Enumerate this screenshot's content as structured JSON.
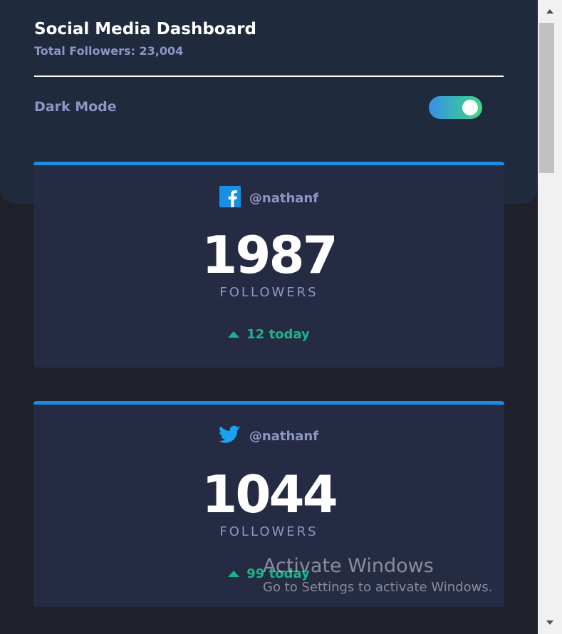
{
  "header": {
    "title": "Social Media Dashboard",
    "subtitle": "Total Followers: 23,004"
  },
  "dark_mode": {
    "label": "Dark Mode",
    "enabled": true
  },
  "cards": [
    {
      "platform": "facebook",
      "icon": "facebook-icon",
      "accent": "#178fe6",
      "handle": "@nathanf",
      "count": "1987",
      "metric_label": "FOLLOWERS",
      "change": "12 today",
      "change_direction": "up"
    },
    {
      "platform": "twitter",
      "icon": "twitter-icon",
      "accent": "#1ca0f2",
      "handle": "@nathanf",
      "count": "1044",
      "metric_label": "FOLLOWERS",
      "change": "99 today",
      "change_direction": "up"
    }
  ],
  "colors": {
    "background": "#1e202a",
    "header_bg": "#1f2a3c",
    "card_bg": "#252b43",
    "text_muted": "#8b97c6",
    "positive": "#1db489"
  },
  "watermark": {
    "title": "Activate Windows",
    "subtitle": "Go to Settings to activate Windows."
  }
}
